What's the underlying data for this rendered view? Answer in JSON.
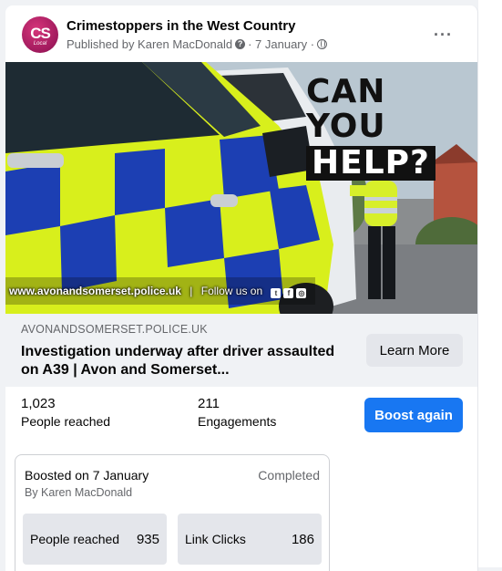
{
  "post": {
    "page_name": "Crimestoppers in the West Country",
    "published_by": "Published by Karen MacDonald",
    "date": "· 7 January ·",
    "avatar_text": "CS",
    "avatar_sub": "Local",
    "more": "···"
  },
  "image": {
    "headline_line1": "CAN YOU",
    "headline_line2": "HELP?",
    "footer_url": "www.avonandsomerset.police.uk",
    "footer_sep": "|",
    "footer_follow": "Follow us on"
  },
  "link": {
    "domain": "AVONANDSOMERSET.POLICE.UK",
    "title": "Investigation underway after driver assaulted on A39 | Avon and Somerset...",
    "cta": "Learn More"
  },
  "stats": {
    "reached_value": "1,023",
    "reached_label": "People reached",
    "engagements_value": "211",
    "engagements_label": "Engagements",
    "boost_button": "Boost again"
  },
  "boost": {
    "boosted_on": "Boosted on 7 January",
    "status": "Completed",
    "by": "By Karen MacDonald",
    "metrics": [
      {
        "label": "People reached",
        "value": "935"
      },
      {
        "label": "Link Clicks",
        "value": "186"
      }
    ]
  },
  "colors": {
    "brand_blue": "#1877f2",
    "police_yellow": "#d8ef1c",
    "police_blue": "#1c3fb3"
  }
}
